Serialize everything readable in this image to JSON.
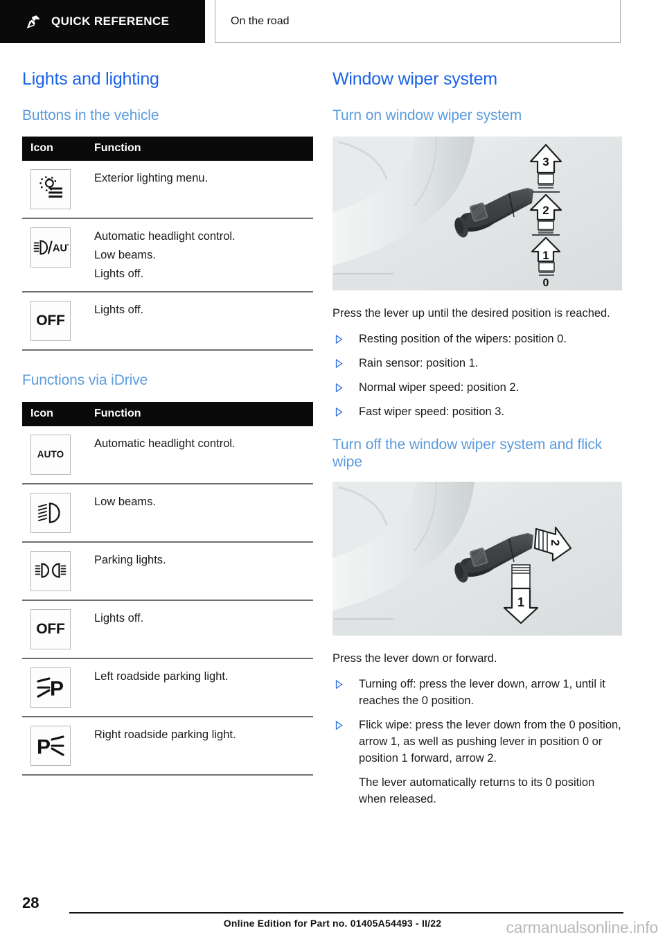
{
  "header": {
    "tab_label": "QUICK REFERENCE",
    "pin_icon": "pushpin-icon",
    "breadcrumb": "On the road"
  },
  "left_column": {
    "section_title": "Lights and lighting",
    "subsection_1_title": "Buttons in the vehicle",
    "table_1": {
      "columns": [
        "Icon",
        "Function"
      ],
      "rows": [
        {
          "icon": "exterior-lighting-menu-icon",
          "lines": [
            "Exterior lighting menu."
          ]
        },
        {
          "icon": "automatic-headlight-auto-icon",
          "lines": [
            "Automatic headlight control.",
            "Low beams.",
            "Lights off."
          ]
        },
        {
          "icon": "off-icon",
          "lines": [
            "Lights off."
          ]
        }
      ]
    },
    "subsection_2_title": "Functions via iDrive",
    "table_2": {
      "columns": [
        "Icon",
        "Function"
      ],
      "rows": [
        {
          "icon": "auto-icon",
          "lines": [
            "Automatic headlight control."
          ]
        },
        {
          "icon": "low-beams-icon",
          "lines": [
            "Low beams."
          ]
        },
        {
          "icon": "parking-lights-icon",
          "lines": [
            "Parking lights."
          ]
        },
        {
          "icon": "off-icon",
          "lines": [
            "Lights off."
          ]
        },
        {
          "icon": "left-roadside-parking-light-icon",
          "lines": [
            "Left roadside parking light."
          ]
        },
        {
          "icon": "right-roadside-parking-light-icon",
          "lines": [
            "Right roadside parking light."
          ]
        }
      ]
    }
  },
  "right_column": {
    "section_title": "Window wiper system",
    "block_1": {
      "subtitle": "Turn on window wiper system",
      "figure_alt": "Wiper stalk lever with up arrows labeled 1, 2, 3 and base position 0",
      "figure_labels": [
        "3",
        "2",
        "1",
        "0"
      ],
      "intro": "Press the lever up until the desired position is reached.",
      "bullets": [
        "Resting position of the wipers: position 0.",
        "Rain sensor: position 1.",
        "Normal wiper speed: position 2.",
        "Fast wiper speed: position 3."
      ]
    },
    "block_2": {
      "subtitle": "Turn off the window wiper system and flick wipe",
      "figure_alt": "Wiper stalk lever with down arrow 1 and forward arrow 2",
      "figure_labels": [
        "1",
        "2"
      ],
      "intro": "Press the lever down or forward.",
      "bullets": [
        "Turning off: press the lever down, arrow 1, until it reaches the 0 position.",
        "Flick wipe: press the lever down from the 0 position, arrow 1, as well as pushing lever in position 0 or position 1 forward, arrow 2."
      ],
      "bullet_2_followup": "The lever automatically returns to its 0 position when released."
    }
  },
  "footer": {
    "page_number": "28",
    "edition_note": "Online Edition for Part no. 01405A54493 - II/22",
    "watermark": "carmanualsonline.info"
  },
  "colors": {
    "heading_primary": "#1a62e8",
    "heading_secondary": "#5b9bdd",
    "table_header_bg": "#0a0a0a",
    "bullet_marker": "#2b6fe0",
    "watermark": "#b9b9b9"
  }
}
